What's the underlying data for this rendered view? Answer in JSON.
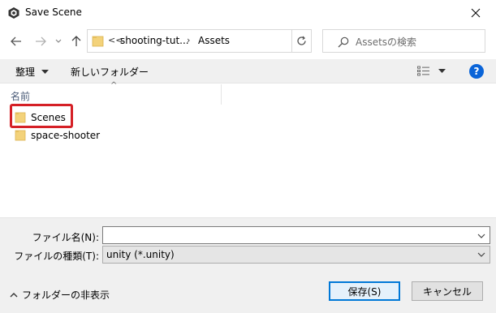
{
  "window": {
    "title": "Save Scene"
  },
  "address": {
    "overflow": "<<",
    "segments": [
      "shooting-tut...",
      "Assets"
    ]
  },
  "search": {
    "placeholder": "Assetsの検索"
  },
  "toolbar": {
    "organize": "整理",
    "new_folder": "新しいフォルダー",
    "help": "?"
  },
  "list": {
    "column_name": "名前",
    "items": [
      {
        "name": "Scenes"
      },
      {
        "name": "space-shooter"
      }
    ]
  },
  "form": {
    "filename_label": "ファイル名(N):",
    "filename_value": "",
    "filetype_label": "ファイルの種類(T):",
    "filetype_value": "unity (*.unity)"
  },
  "footer": {
    "hide_folders": "フォルダーの非表示",
    "save": "保存(S)",
    "cancel": "キャンセル"
  },
  "colors": {
    "accent": "#0078d7",
    "highlight": "#d52026",
    "folder": "#f3d27a"
  }
}
